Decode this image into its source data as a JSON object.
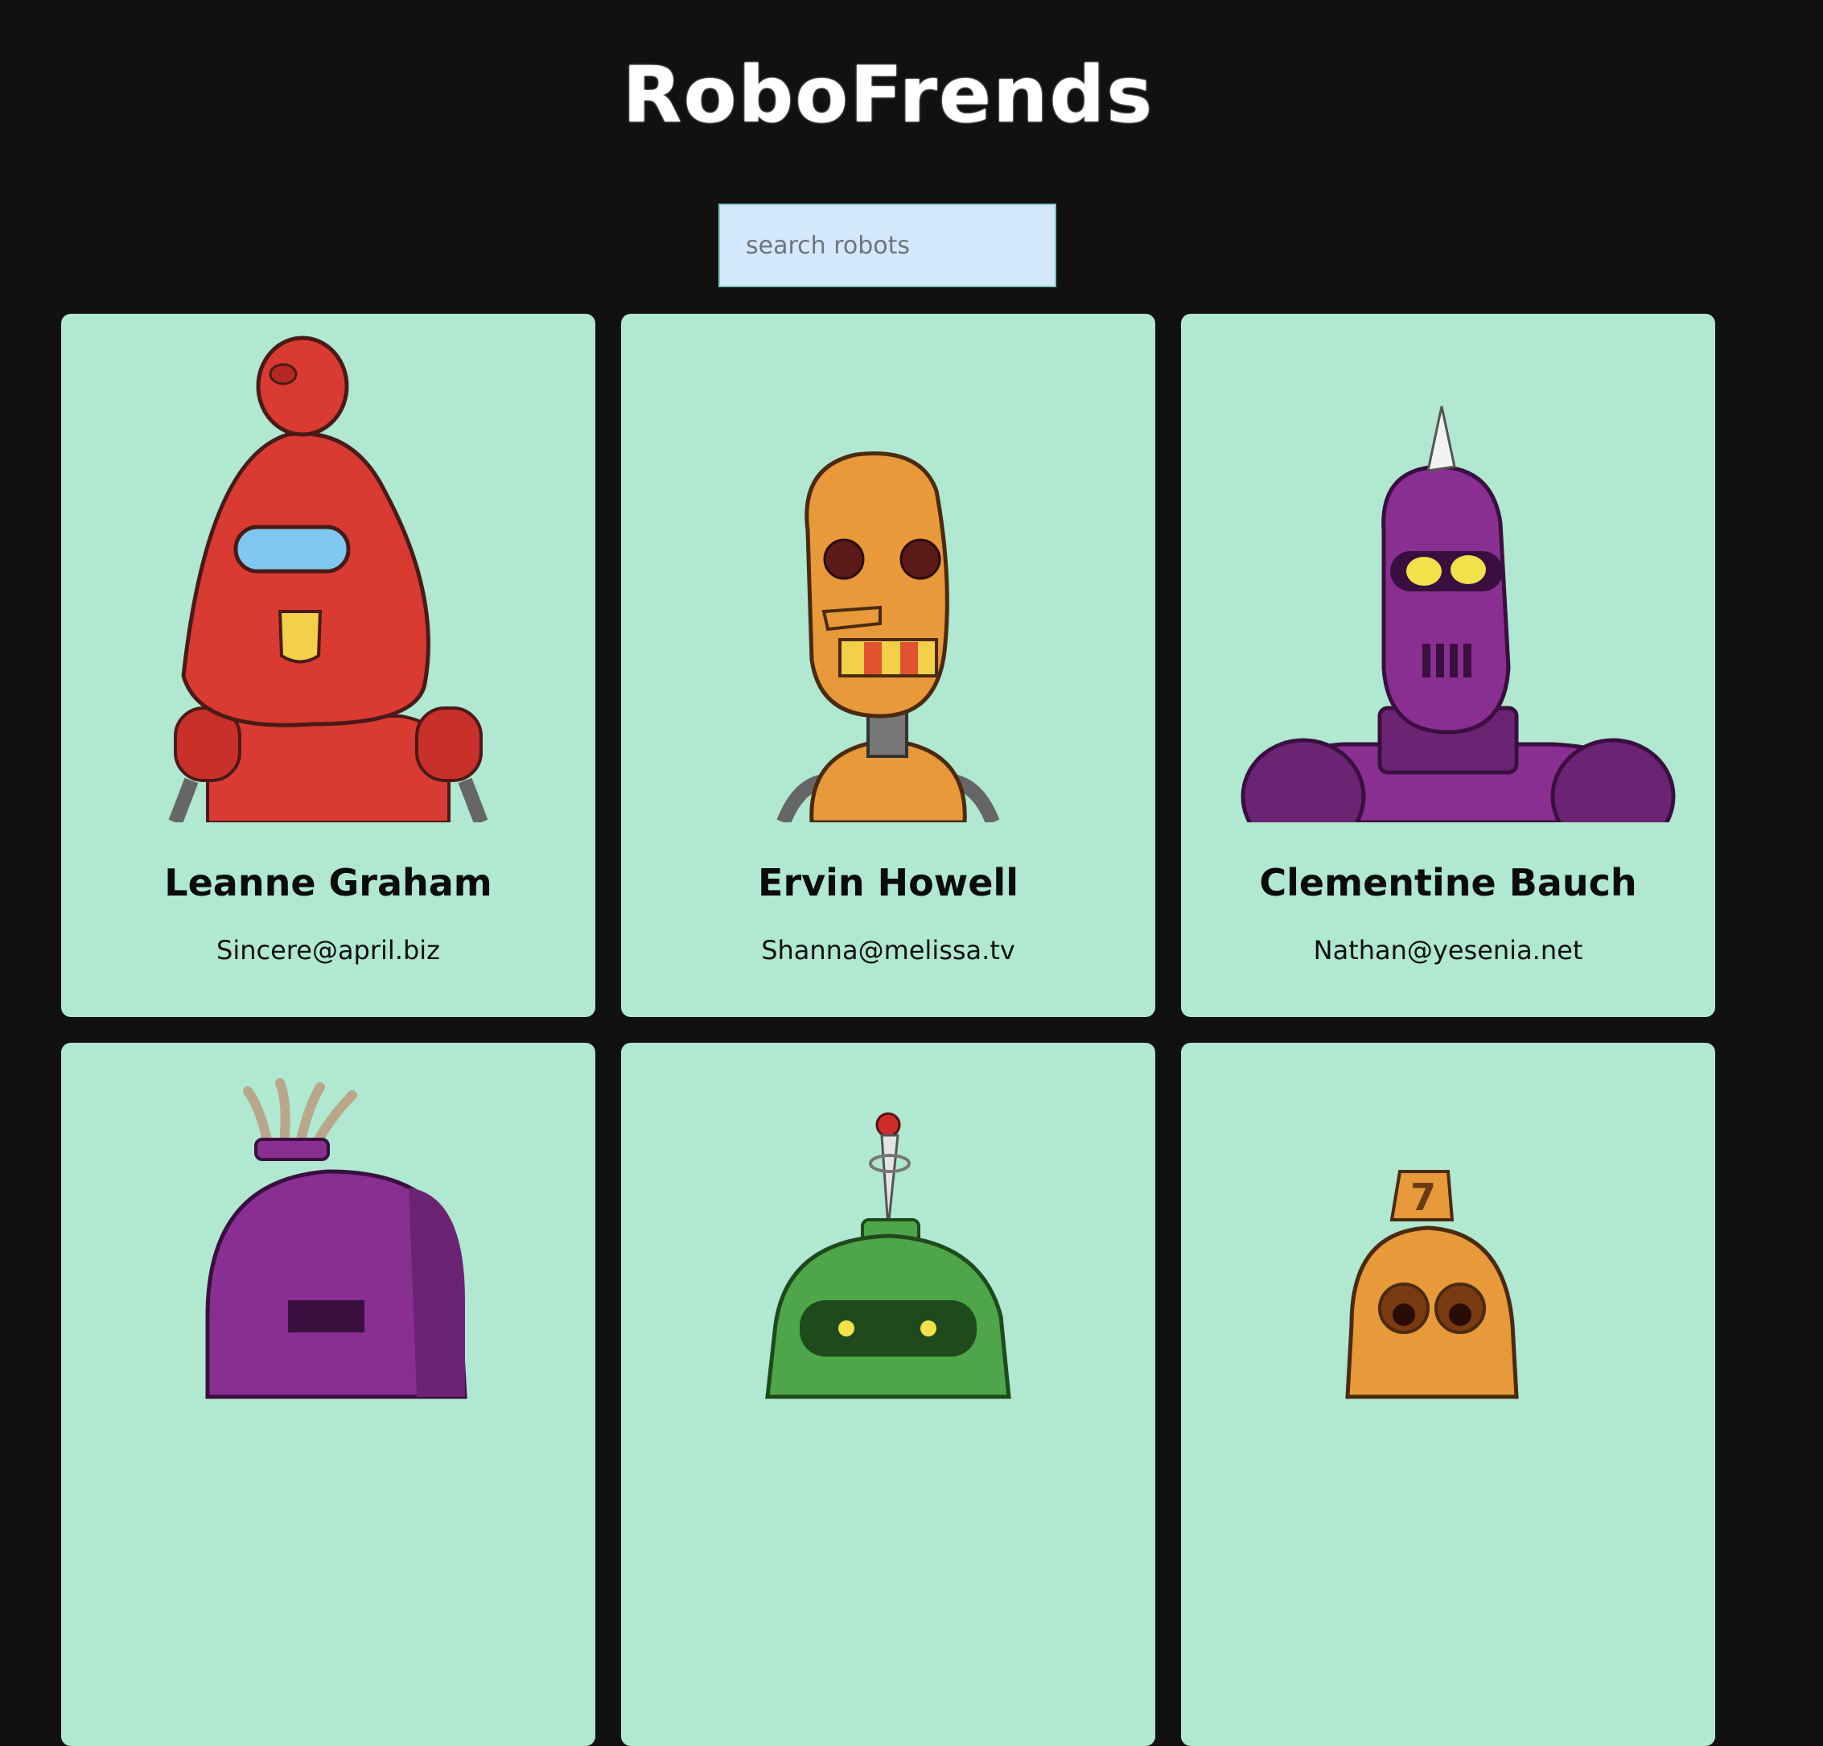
{
  "app": {
    "title": "RoboFrends"
  },
  "search": {
    "placeholder": "search robots",
    "value": ""
  },
  "robots": [
    {
      "name": "Leanne Graham",
      "email": "Sincere@april.biz",
      "color": "#d93a32"
    },
    {
      "name": "Ervin Howell",
      "email": "Shanna@melissa.tv",
      "color": "#e8993a"
    },
    {
      "name": "Clementine Bauch",
      "email": "Nathan@yesenia.net",
      "color": "#8a2f92"
    },
    {
      "name": "",
      "email": "",
      "color": "#8a2f92"
    },
    {
      "name": "",
      "email": "",
      "color": "#4fa54a"
    },
    {
      "name": "",
      "email": "",
      "color": "#e8993a"
    }
  ]
}
